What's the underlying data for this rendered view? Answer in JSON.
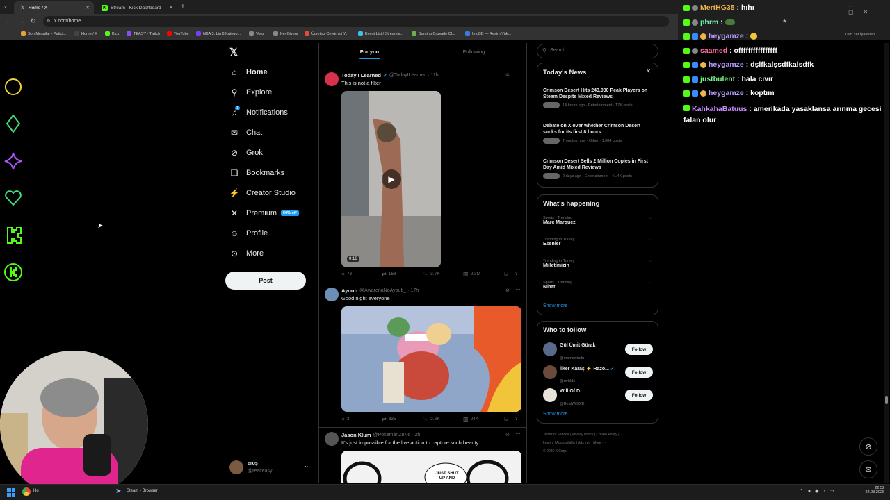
{
  "browser": {
    "tabs": [
      {
        "label": "Home / X",
        "icon": "x-logo-icon"
      },
      {
        "label": "Stream - Kick Dashboard",
        "icon": "kick-logo-icon"
      }
    ],
    "url": "x.com/home",
    "bookmarks": [
      "Son Mesajlar - Patici...",
      "Home / X",
      "Kick",
      "TEASY - Twitch",
      "YouTube",
      "NBA 3. Lig 8 Katego...",
      "Vorp",
      "KeyGivers",
      "Ücretsiz Çevrimiçi Y...",
      "Event List / Streamla...",
      "Burning Crusade Cl...",
      "ImgBB — Resim Yük...",
      "Tüm Yer İşaretleri"
    ]
  },
  "nav": {
    "items": [
      {
        "label": "Home",
        "icon": "home-icon"
      },
      {
        "label": "Explore",
        "icon": "search-icon"
      },
      {
        "label": "Notifications",
        "icon": "bell-icon"
      },
      {
        "label": "Chat",
        "icon": "envelope-icon"
      },
      {
        "label": "Grok",
        "icon": "grok-icon"
      },
      {
        "label": "Bookmarks",
        "icon": "bookmark-icon"
      },
      {
        "label": "Creator Studio",
        "icon": "creator-icon"
      },
      {
        "label": "Premium",
        "icon": "x-icon"
      },
      {
        "label": "Profile",
        "icon": "person-icon"
      },
      {
        "label": "More",
        "icon": "more-circle-icon"
      }
    ],
    "premium_badge": "50% off",
    "notif_count": "1",
    "post_label": "Post",
    "account_name": "eroş",
    "account_handle": "@realteasy"
  },
  "feed": {
    "tabs": [
      "For you",
      "Following"
    ],
    "tweets": [
      {
        "name": "Today I Learned",
        "handle": "@TodayILearned · 11h",
        "text": "This is not a filter",
        "duration": "0:16",
        "replies": "73",
        "reposts": "168",
        "likes": "3.7K",
        "views": "2.3M"
      },
      {
        "name": "Ayoub",
        "handle": "@AwarenaNoAyoub_ · 17h",
        "text": "Good night everyone",
        "replies": "3",
        "reposts": "335",
        "likes": "2.6K",
        "views": "24K"
      },
      {
        "name": "Jason Klum",
        "handle": "@PokemanZ8N6 · 2h",
        "text": "It's just impossible for the live action to capture such beauty",
        "manga_text": "JUST SHUT UP AND"
      }
    ]
  },
  "sidebar": {
    "search_placeholder": "Search",
    "news_title": "Today's News",
    "news": [
      {
        "title": "Crimson Desert Hits 243,000 Peak Players on Steam Despite Mixed Reviews",
        "meta": "14 hours ago · Entertainment · 17K posts"
      },
      {
        "title": "Debate on X over whether Crimson Desert sucks for its first 8 hours",
        "meta": "Trending now · Other · 1,084 posts"
      },
      {
        "title": "Crimson Desert Sells 2 Million Copies in First Day Amid Mixed Reviews",
        "meta": "2 days ago · Entertainment · 41.4K posts"
      }
    ],
    "happening_title": "What's happening",
    "trends": [
      {
        "context": "Sports · Trending",
        "name": "Marc Marquez"
      },
      {
        "context": "Trending in Turkey",
        "name": "Esenler"
      },
      {
        "context": "Trending in Turkey",
        "name": "Milletimizin"
      },
      {
        "context": "Sports · Trending",
        "name": "Nihat"
      }
    ],
    "show_more": "Show more",
    "follow_title": "Who to follow",
    "follow": [
      {
        "name": "Gül Ümit Gürak",
        "handle": "@mamawindu"
      },
      {
        "name": "İlker Karaş ⚡ Razo...",
        "handle": "@rzrblds"
      },
      {
        "name": "Will Of D.",
        "handle": "@RealWillOfD"
      }
    ],
    "follow_label": "Follow",
    "footer": [
      "Terms of Service",
      "Privacy Policy",
      "Cookie Policy",
      "Imprint",
      "Accessibility",
      "Ads info",
      "More ···",
      "© 2026 X Corp."
    ]
  },
  "chat": [
    {
      "user": "MertHG35",
      "msg": "hıhı",
      "color": "#f0b24a"
    },
    {
      "user": "phrm",
      "msg": "",
      "color": "#6cf0b0"
    },
    {
      "user": "heygamze",
      "msg": "",
      "color": "#b99cff"
    },
    {
      "user": "saamed",
      "msg": "offffffffffffffff",
      "color": "#ff6b9a"
    },
    {
      "user": "heygamze",
      "msg": "dşlfkalşsdfkalsdfk",
      "color": "#b99cff"
    },
    {
      "user": "justbulent",
      "msg": "hala cıvır",
      "color": "#7bf08a"
    },
    {
      "user": "heygamze",
      "msg": "koptım",
      "color": "#b99cff"
    },
    {
      "user": "KahkahaBatuus",
      "msg": "amerikada yasaklansa arınma gecesi falan olur",
      "color": "#c98cff"
    }
  ],
  "taskbar": {
    "items": [
      "Ho",
      "Steam - Browser"
    ],
    "time": "22:52",
    "date": "22.03.2026"
  },
  "colors": {
    "accent": "#1d9bf0",
    "kick": "#53fc18",
    "bg": "#000000"
  }
}
